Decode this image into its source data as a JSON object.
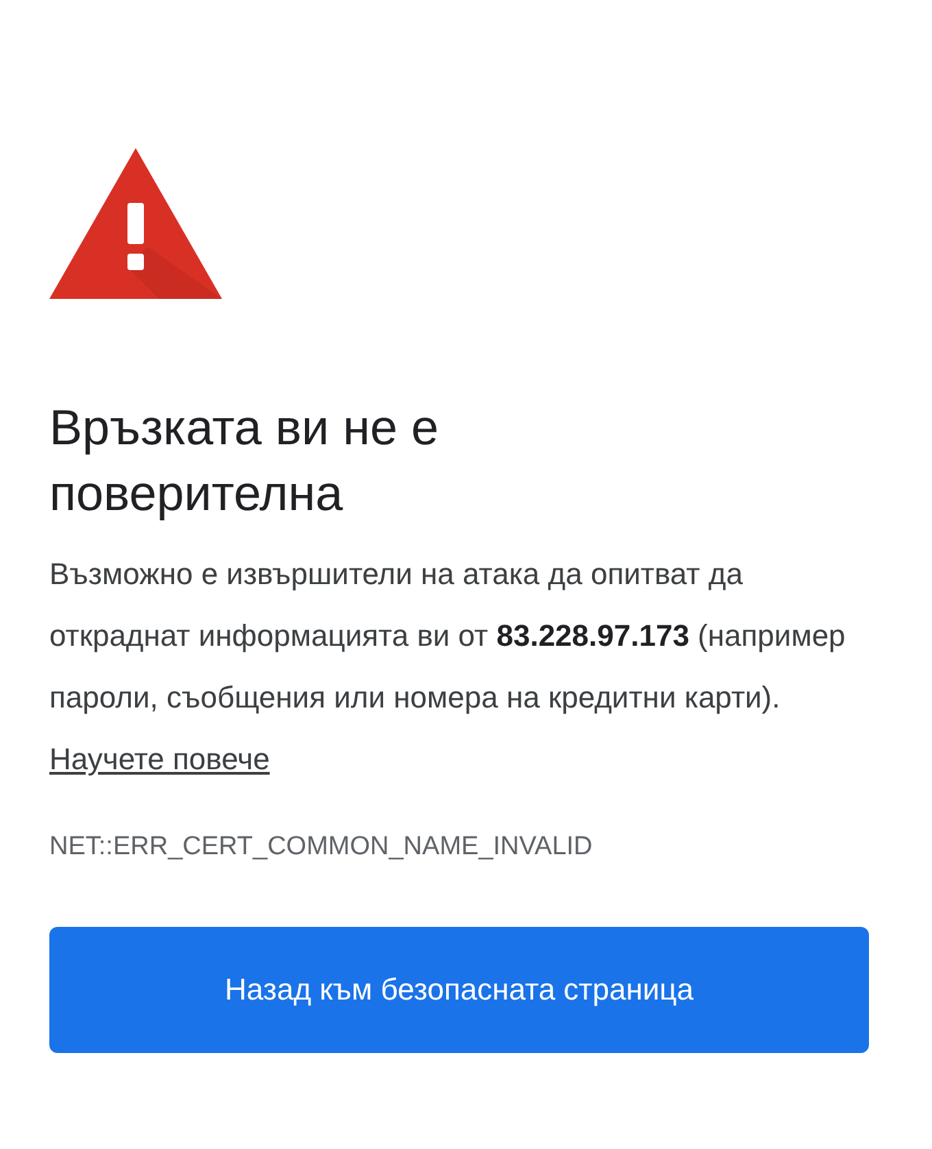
{
  "heading": "Връзката ви не е поверителна",
  "message": {
    "text": "Възможно е извършители на атака да опитват да откраднат информацията ви от **83.228.97.173** (например пароли, съобщения или номера на кредитни карти).",
    "link": "Научете повече"
  },
  "error_code": "NET::ERR_CERT_COMMON_NAME_INVALID",
  "button": "Назад към безопасната страница"
}
